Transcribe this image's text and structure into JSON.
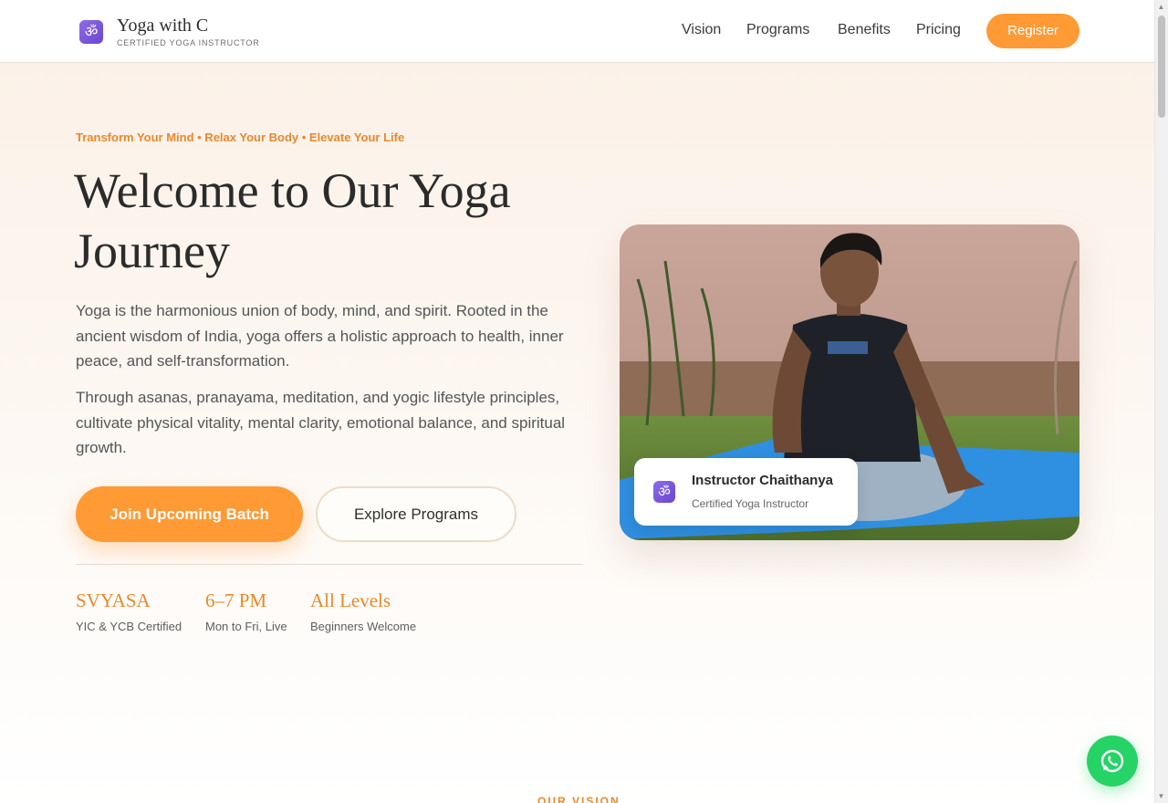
{
  "header": {
    "logo_glyph": "ॐ",
    "title": "Yoga with C",
    "subtitle": "CERTIFIED YOGA INSTRUCTOR",
    "nav": [
      "Vision",
      "Programs",
      "Benefits",
      "Pricing"
    ],
    "register_label": "Register"
  },
  "hero": {
    "tagline": "Transform Your Mind • Relax Your Body • Elevate Your Life",
    "title": "Welcome to Our Yoga Journey",
    "paragraph1": "Yoga is the harmonious union of body, mind, and spirit. Rooted in the ancient wisdom of India, yoga offers a holistic approach to health, inner peace, and self-transformation.",
    "paragraph2": "Through asanas, pranayama, meditation, and yogic lifestyle principles, cultivate physical vitality, mental clarity, emotional balance, and spiritual growth.",
    "primary_button": "Join Upcoming Batch",
    "secondary_button": "Explore Programs",
    "stats": [
      {
        "value": "SVYASA",
        "label": "YIC & YCB Certified"
      },
      {
        "value": "6–7 PM",
        "label": "Mon to Fri, Live"
      },
      {
        "value": "All Levels",
        "label": "Beginners Welcome"
      }
    ]
  },
  "instructor": {
    "logo_glyph": "ॐ",
    "name": "Instructor Chaithanya",
    "role": "Certified Yoga Instructor"
  },
  "vision_section": {
    "label": "OUR VISION"
  },
  "colors": {
    "accent": "#ff9a35",
    "accent_text": "#e8892b",
    "whatsapp": "#25d366",
    "brand_purple": "#7a58de"
  }
}
